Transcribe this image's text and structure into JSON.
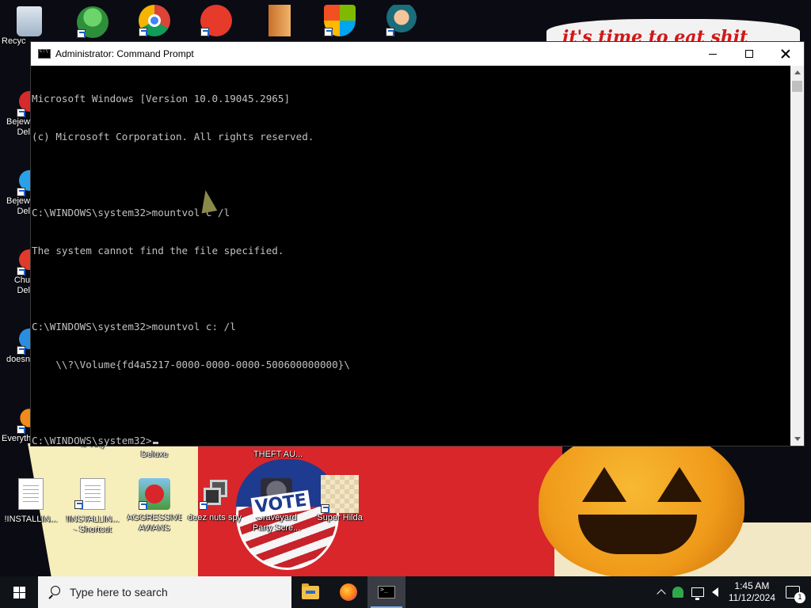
{
  "window": {
    "title": "Administrator: Command Prompt",
    "console_lines": [
      "Microsoft Windows [Version 10.0.19045.2965]",
      "(c) Microsoft Corporation. All rights reserved.",
      "",
      "C:\\WINDOWS\\system32>mountvol c /l",
      "The system cannot find the file specified.",
      "",
      "C:\\WINDOWS\\system32>mountvol c: /l",
      "    \\\\?\\Volume{fd4a5217-0000-0000-0000-500600000000}\\",
      "",
      "C:\\WINDOWS\\system32>"
    ]
  },
  "desktop": {
    "wallpaper_text": "it's time to eat shit",
    "vote_text": "VOTE",
    "icons_left": [
      "Recyc",
      "Bejew Del",
      "Bejew Del",
      "Chu Del",
      "doesn",
      "Everything"
    ],
    "partial_labels": [
      "is very",
      "Deluxe",
      "Deluxe",
      "THEFT AU...",
      ""
    ],
    "bottom_icons": [
      {
        "label": "!INSTALLIN...",
        "icon": "document-icon"
      },
      {
        "label": "!INSTALLIN... - Shortcut",
        "icon": "document-shortcut-icon"
      },
      {
        "label": "AGGRESSIVE AVIANS",
        "icon": "angry-bird-icon"
      },
      {
        "label": "deez nuts spy",
        "icon": "stacked-windows-icon"
      },
      {
        "label": "Graveyard Party Scre...",
        "icon": "graveyard-icon"
      },
      {
        "label": "Super Hilda",
        "icon": "pixel-dog-icon"
      }
    ]
  },
  "taskbar": {
    "search_placeholder": "Type here to search",
    "time": "1:45 AM",
    "date": "11/12/2024",
    "notification_count": "1"
  },
  "colors": {
    "console_bg": "#000000",
    "console_text": "#c0c0c0",
    "taskbar_bg": "#101318",
    "accent": "#7ab4ff"
  }
}
